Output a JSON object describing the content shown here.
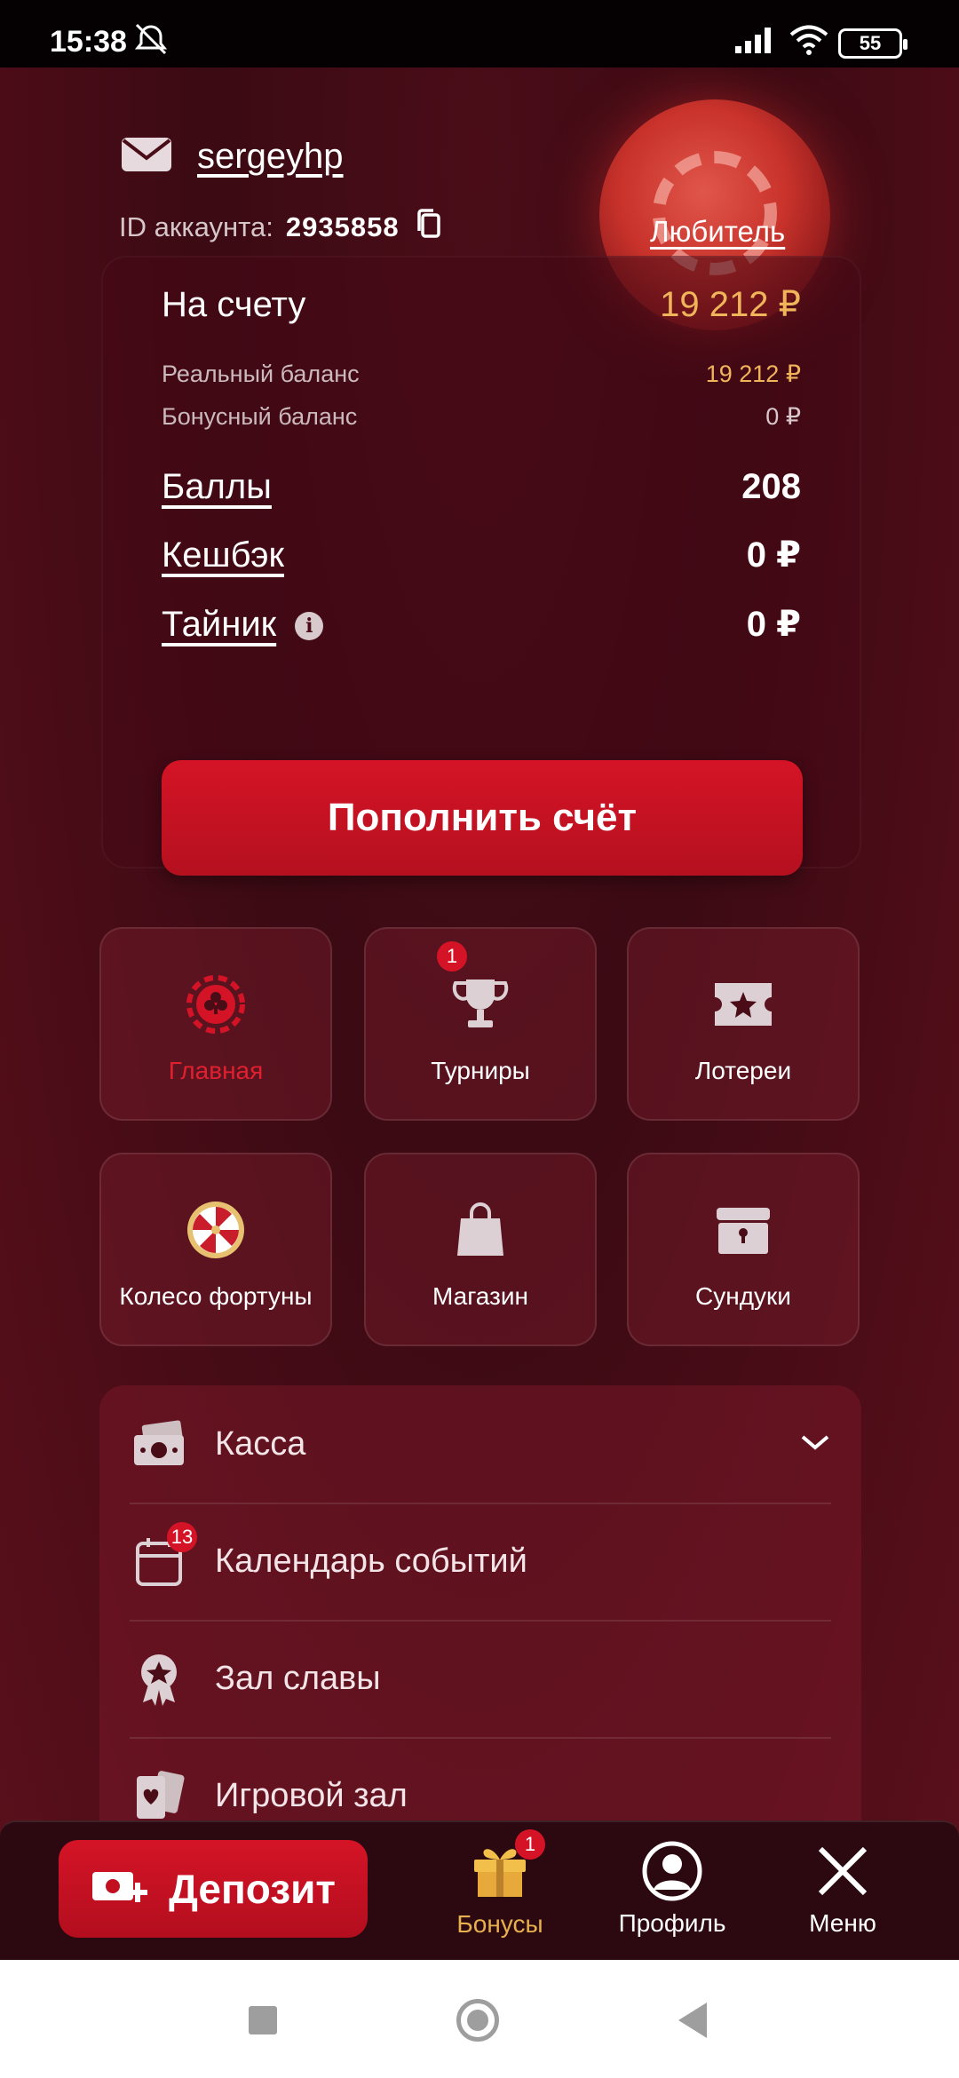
{
  "status_bar": {
    "time": "15:38",
    "battery": "55"
  },
  "account": {
    "username": "sergeyhp",
    "id_label": "ID аккаунта:",
    "id_value": "2935858",
    "rank": "Любитель"
  },
  "balance": {
    "total_label": "На счету",
    "total_value": "19 212 ₽",
    "real_label": "Реальный баланс",
    "real_value": "19 212 ₽",
    "bonus_label": "Бонусный баланс",
    "bonus_value": "0 ₽",
    "points_label": "Баллы",
    "points_value": "208",
    "cashback_label": "Кешбэк",
    "cashback_value": "0 ₽",
    "stash_label": "Тайник",
    "stash_value": "0 ₽",
    "topup_label": "Пополнить счёт"
  },
  "tiles": [
    {
      "label": "Главная",
      "icon": "club-chip-icon"
    },
    {
      "label": "Турниры",
      "icon": "trophy-icon",
      "badge": "1"
    },
    {
      "label": "Лотереи",
      "icon": "ticket-star-icon"
    },
    {
      "label": "Колесо фортуны",
      "icon": "fortune-wheel-icon"
    },
    {
      "label": "Магазин",
      "icon": "shopping-bag-icon"
    },
    {
      "label": "Сундуки",
      "icon": "chest-icon"
    }
  ],
  "menu": [
    {
      "label": "Касса",
      "icon": "cash-icon"
    },
    {
      "label": "Календарь событий",
      "icon": "calendar-icon",
      "badge": "13"
    },
    {
      "label": "Зал славы",
      "icon": "award-icon"
    },
    {
      "label": "Игровой зал",
      "icon": "cards-icon"
    }
  ],
  "bottom_nav": {
    "deposit": "Депозит",
    "bonuses": "Бонусы",
    "bonuses_badge": "1",
    "profile": "Профиль",
    "menu": "Меню"
  },
  "colors": {
    "accent": "#d41426",
    "gold": "#f0b45a",
    "background": "#4a0d18"
  }
}
